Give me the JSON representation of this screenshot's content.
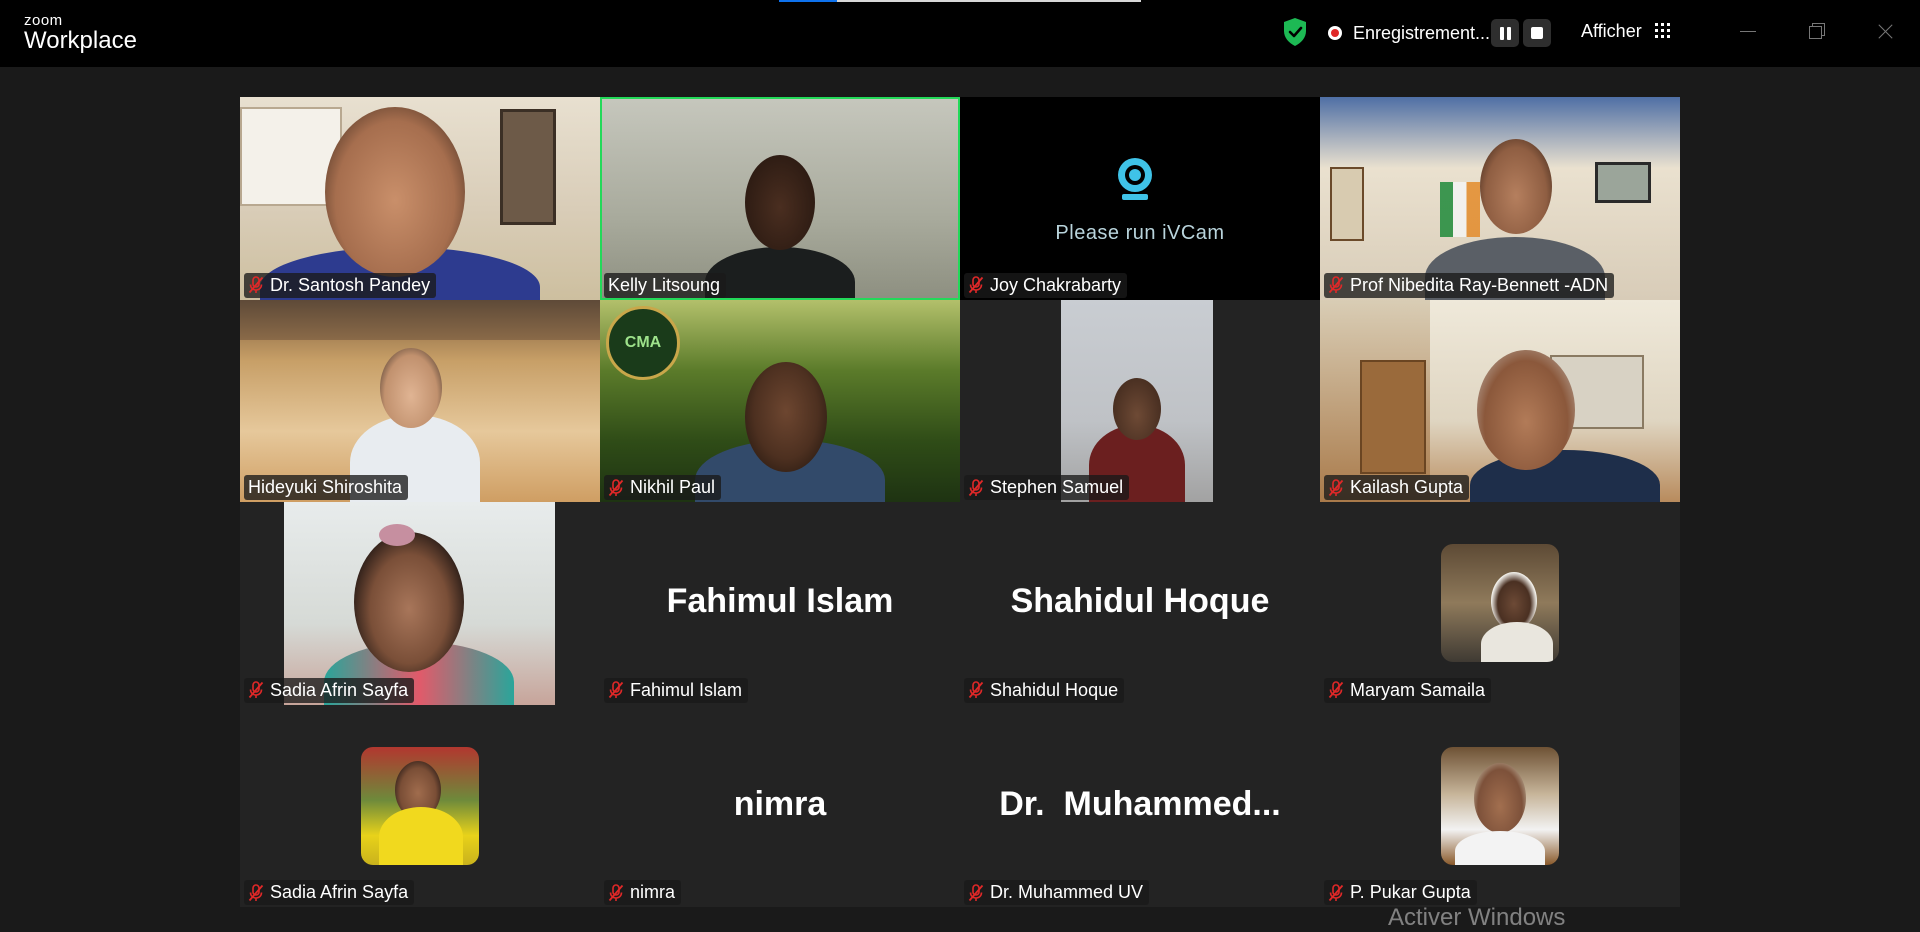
{
  "app": {
    "logo_small": "zoom",
    "logo_big": "Workplace"
  },
  "header": {
    "recording_label": "Enregistrement...",
    "view_label": "Afficher",
    "recording_progress": 0.16
  },
  "colors": {
    "speaker_border": "#23d959",
    "mute_red": "#e02828",
    "shield_green": "#1db954"
  },
  "tiles": [
    {
      "label": "Dr. Santosh Pandey",
      "muted": true,
      "type": "video"
    },
    {
      "label": "Kelly Litsoung",
      "muted": false,
      "type": "video",
      "active_speaker": true
    },
    {
      "label": "Joy Chakrabarty",
      "muted": true,
      "type": "camera-message",
      "message": "Please run iVCam"
    },
    {
      "label": "Prof Nibedita Ray-Bennett -ADN",
      "muted": true,
      "type": "video"
    },
    {
      "label": "Hideyuki Shiroshita",
      "muted": false,
      "type": "video"
    },
    {
      "label": "Nikhil Paul",
      "muted": true,
      "type": "video",
      "badge_text": "CMA"
    },
    {
      "label": "Stephen Samuel",
      "muted": true,
      "type": "video"
    },
    {
      "label": "Kailash Gupta",
      "muted": true,
      "type": "video"
    },
    {
      "label": "Sadia Afrin Sayfa",
      "muted": true,
      "type": "video"
    },
    {
      "label": "Fahimul Islam",
      "muted": true,
      "type": "name",
      "display_name": "Fahimul Islam"
    },
    {
      "label": "Shahidul Hoque",
      "muted": true,
      "type": "name",
      "display_name": "Shahidul Hoque"
    },
    {
      "label": "Maryam Samaila",
      "muted": true,
      "type": "avatar"
    },
    {
      "label": "Sadia Afrin Sayfa",
      "muted": true,
      "type": "avatar"
    },
    {
      "label": "nimra",
      "muted": true,
      "type": "name",
      "display_name": "nimra"
    },
    {
      "label": "Dr. Muhammed UV",
      "muted": true,
      "type": "name",
      "display_name": "Dr.  Muhammed..."
    },
    {
      "label": "P. Pukar Gupta",
      "muted": true,
      "type": "avatar"
    }
  ],
  "os_watermark": "Activer Windows"
}
